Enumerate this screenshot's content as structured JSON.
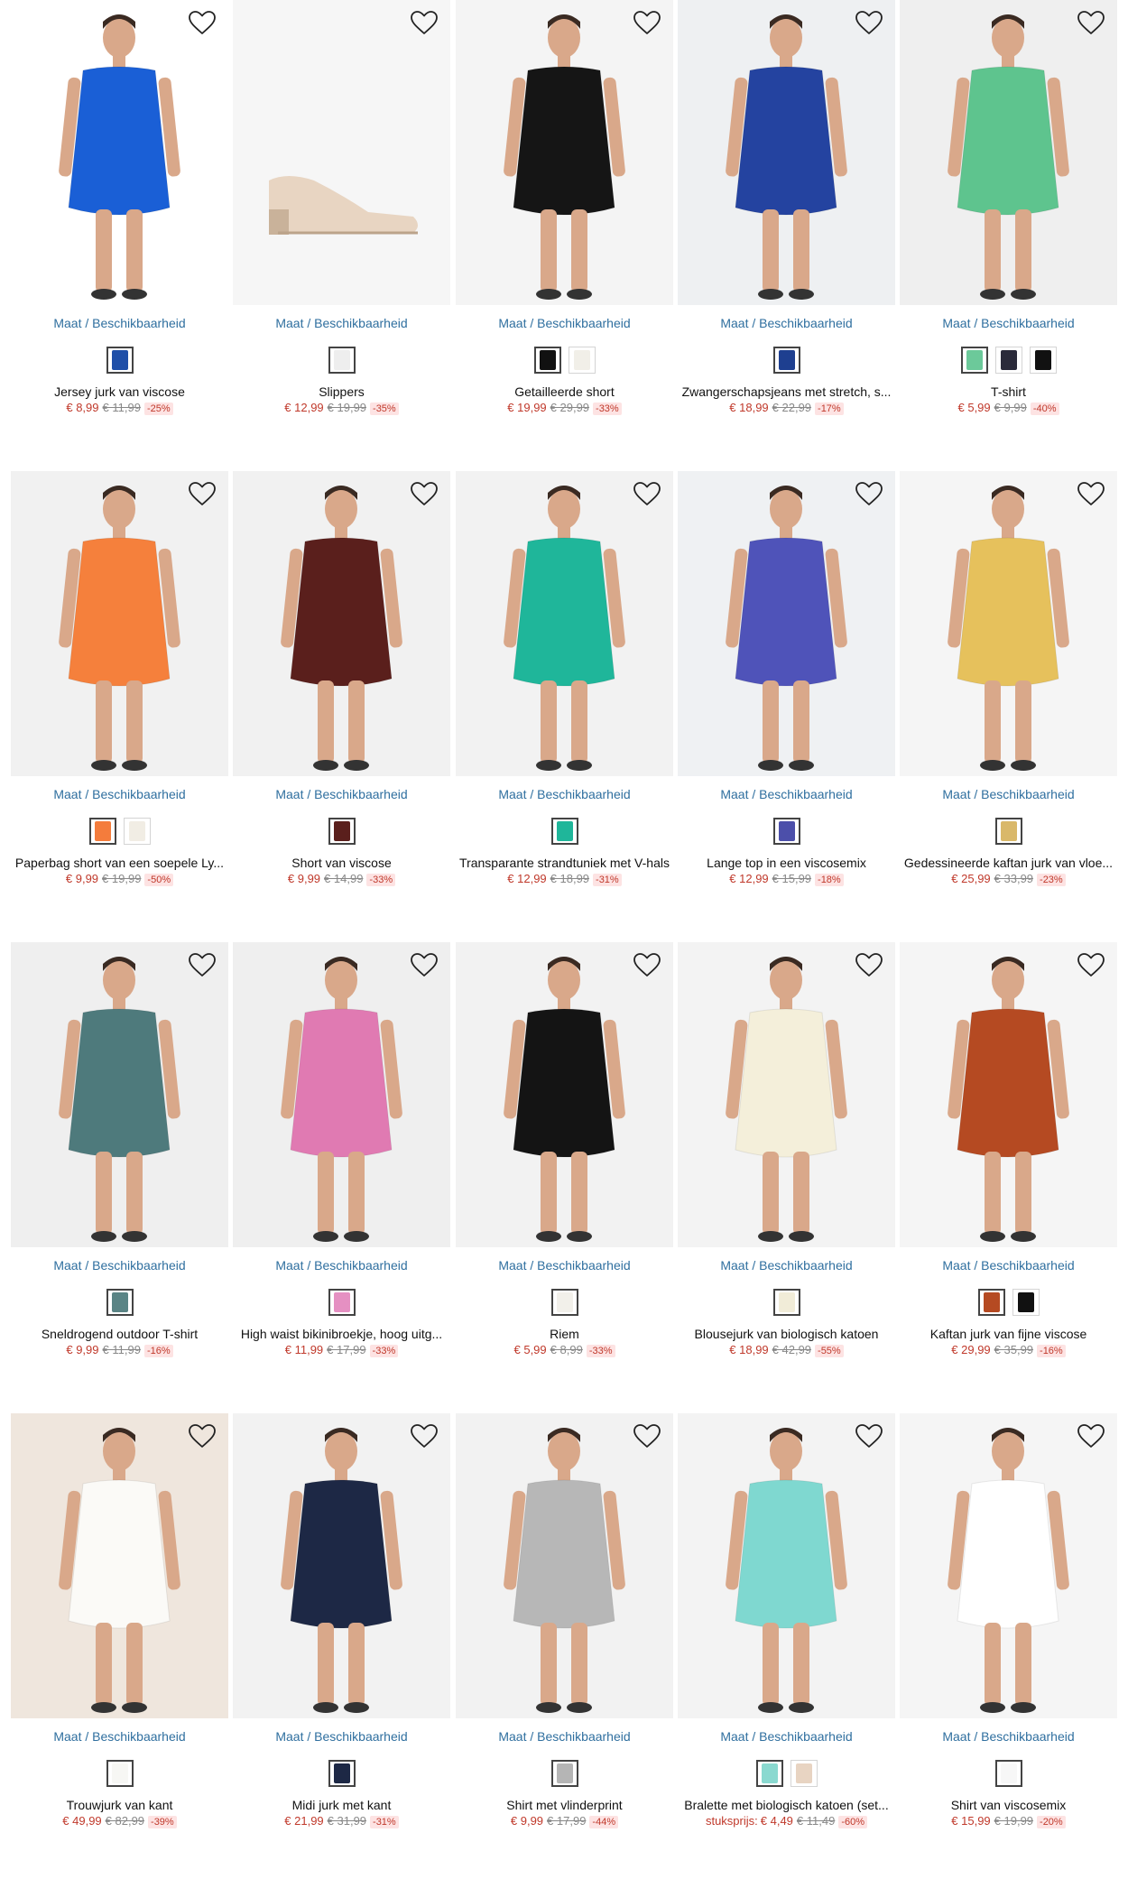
{
  "common": {
    "size_link_label": "Maat / Beschikbaarheid",
    "wishlist_icon": "heart-outline-icon"
  },
  "products": [
    {
      "name": "Jersey jurk van viscose",
      "price": "€ 8,99",
      "old_price": "€ 11,99",
      "discount": "-25%",
      "bg": "#ffffff",
      "main_color": "#1a5fd6",
      "swatches": [
        "#1f4fa8"
      ]
    },
    {
      "name": "Slippers",
      "price": "€ 12,99",
      "old_price": "€ 19,99",
      "discount": "-35%",
      "bg": "#f6f6f6",
      "main_color": "#e8d5c2",
      "swatches": [
        "#eeeeee"
      ]
    },
    {
      "name": "Getailleerde short",
      "price": "€ 19,99",
      "old_price": "€ 29,99",
      "discount": "-33%",
      "bg": "#f4f4f4",
      "main_color": "#151515",
      "swatches": [
        "#111111",
        "#f1efe8"
      ]
    },
    {
      "name": "Zwangerschapsjeans met stretch, s...",
      "price": "€ 18,99",
      "old_price": "€ 22,99",
      "discount": "-17%",
      "bg": "#eef0f2",
      "main_color": "#2443a0",
      "swatches": [
        "#1e3f90"
      ]
    },
    {
      "name": "T-shirt",
      "price": "€ 5,99",
      "old_price": "€ 9,99",
      "discount": "-40%",
      "bg": "#efefef",
      "main_color": "#5ec48e",
      "swatches": [
        "#6cc99a",
        "#2a2a3a",
        "#111111"
      ]
    },
    {
      "name": "Paperbag short van een soepele Ly...",
      "price": "€ 9,99",
      "old_price": "€ 19,99",
      "discount": "-50%",
      "bg": "#f1f1f1",
      "main_color": "#f5803c",
      "swatches": [
        "#f47c3c",
        "#f1ede4"
      ]
    },
    {
      "name": "Short van viscose",
      "price": "€ 9,99",
      "old_price": "€ 14,99",
      "discount": "-33%",
      "bg": "#f1f1f1",
      "main_color": "#5a1f1c",
      "swatches": [
        "#5a1f1c"
      ]
    },
    {
      "name": "Transparante strandtuniek met V-hals",
      "price": "€ 12,99",
      "old_price": "€ 18,99",
      "discount": "-31%",
      "bg": "#f2f2f2",
      "main_color": "#1fb69a",
      "swatches": [
        "#1fb69a"
      ]
    },
    {
      "name": "Lange top in een viscosemix",
      "price": "€ 12,99",
      "old_price": "€ 15,99",
      "discount": "-18%",
      "bg": "#eff1f3",
      "main_color": "#4f53b9",
      "swatches": [
        "#4c4faa"
      ]
    },
    {
      "name": "Gedessineerde kaftan jurk van vloe...",
      "price": "€ 25,99",
      "old_price": "€ 33,99",
      "discount": "-23%",
      "bg": "#f5f5f5",
      "main_color": "#e6c15c",
      "swatches": [
        "#d9b86a"
      ]
    },
    {
      "name": "Sneldrogend outdoor T-shirt",
      "price": "€ 9,99",
      "old_price": "€ 11,99",
      "discount": "-16%",
      "bg": "#efefef",
      "main_color": "#4e7a7c",
      "swatches": [
        "#5a8485"
      ]
    },
    {
      "name": "High waist bikinibroekje, hoog uitg...",
      "price": "€ 11,99",
      "old_price": "€ 17,99",
      "discount": "-33%",
      "bg": "#efefef",
      "main_color": "#e07ab2",
      "swatches": [
        "#e590c2"
      ]
    },
    {
      "name": "Riem",
      "price": "€ 5,99",
      "old_price": "€ 8,99",
      "discount": "-33%",
      "bg": "#f2f2f2",
      "main_color": "#141414",
      "swatches": [
        "#f2f0ea"
      ]
    },
    {
      "name": "Blousejurk van biologisch katoen",
      "price": "€ 18,99",
      "old_price": "€ 42,99",
      "discount": "-55%",
      "bg": "#f3f3f3",
      "main_color": "#f4efda",
      "swatches": [
        "#f1ecd8"
      ]
    },
    {
      "name": "Kaftan jurk van fijne viscose",
      "price": "€ 29,99",
      "old_price": "€ 35,99",
      "discount": "-16%",
      "bg": "#f5f5f5",
      "main_color": "#b54a22",
      "swatches": [
        "#b54a22",
        "#111111"
      ]
    },
    {
      "name": "Trouwjurk van kant",
      "price": "€ 49,99",
      "old_price": "€ 82,99",
      "discount": "-39%",
      "bg": "#efe6dd",
      "main_color": "#fbfaf7",
      "swatches": [
        "#f7f7f4"
      ]
    },
    {
      "name": "Midi jurk met kant",
      "price": "€ 21,99",
      "old_price": "€ 31,99",
      "discount": "-31%",
      "bg": "#f2f2f2",
      "main_color": "#1d2845",
      "swatches": [
        "#1d2845"
      ]
    },
    {
      "name": "Shirt met vlinderprint",
      "price": "€ 9,99",
      "old_price": "€ 17,99",
      "discount": "-44%",
      "bg": "#f2f2f2",
      "main_color": "#b7b7b7",
      "swatches": [
        "#b5b5b5"
      ]
    },
    {
      "name": "Bralette met biologisch katoen (set...",
      "price_prefix": "stuksprijs:",
      "price": "€ 4,49",
      "old_price": "€ 11,49",
      "discount": "-60%",
      "bg": "#f3f3f3",
      "main_color": "#7fd8d0",
      "swatches": [
        "#8ad9d0",
        "#e8d4c2"
      ]
    },
    {
      "name": "Shirt van viscosemix",
      "price": "€ 15,99",
      "old_price": "€ 19,99",
      "discount": "-20%",
      "bg": "#f5f5f5",
      "main_color": "#ffffff",
      "swatches": [
        "#f7f7f7"
      ]
    }
  ]
}
